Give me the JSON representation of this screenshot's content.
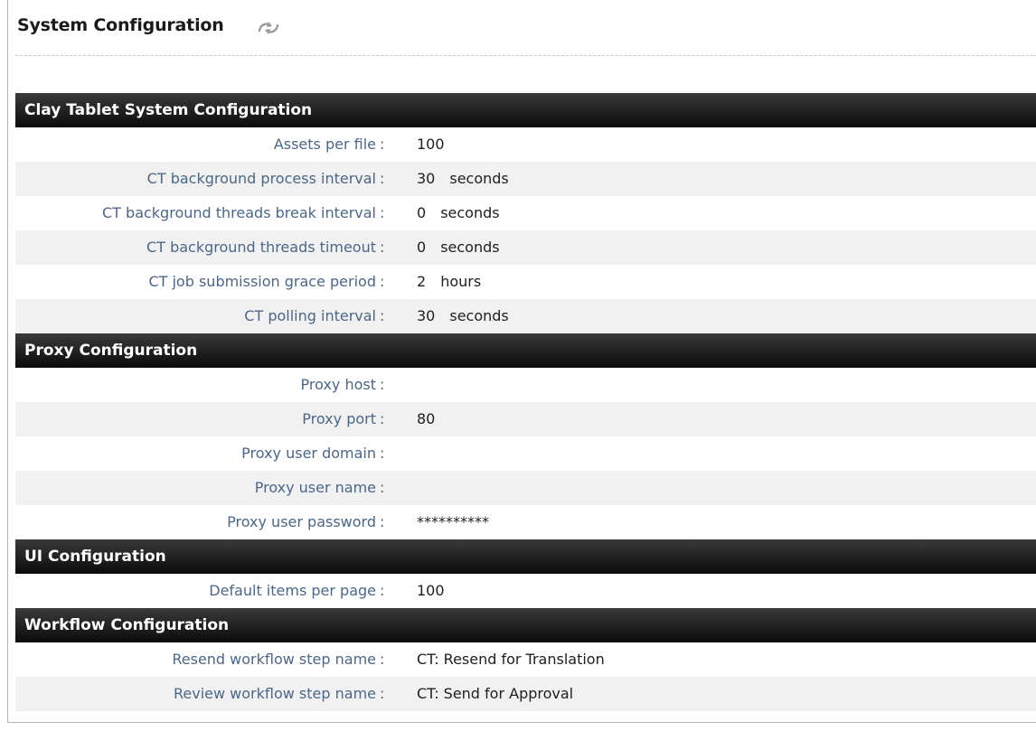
{
  "page": {
    "title": "System Configuration",
    "refresh_icon": "refresh-arrows-icon"
  },
  "sections": [
    {
      "title": "Clay Tablet System Configuration",
      "rows": [
        {
          "label": "Assets per file",
          "value": "100",
          "unit": ""
        },
        {
          "label": "CT background process interval",
          "value": "30",
          "unit": "seconds"
        },
        {
          "label": "CT background threads break interval",
          "value": "0",
          "unit": "seconds"
        },
        {
          "label": "CT background threads timeout",
          "value": "0",
          "unit": "seconds"
        },
        {
          "label": "CT job submission grace period",
          "value": "2",
          "unit": "hours"
        },
        {
          "label": "CT polling interval",
          "value": "30",
          "unit": "seconds"
        }
      ]
    },
    {
      "title": "Proxy Configuration",
      "rows": [
        {
          "label": "Proxy host",
          "value": "",
          "unit": ""
        },
        {
          "label": "Proxy port",
          "value": "80",
          "unit": ""
        },
        {
          "label": "Proxy user domain",
          "value": "",
          "unit": ""
        },
        {
          "label": "Proxy user name",
          "value": "",
          "unit": ""
        },
        {
          "label": "Proxy user password",
          "value": "**********",
          "unit": ""
        }
      ]
    },
    {
      "title": "UI Configuration",
      "rows": [
        {
          "label": "Default items per page",
          "value": "100",
          "unit": ""
        }
      ]
    },
    {
      "title": "Workflow Configuration",
      "rows": [
        {
          "label": "Resend workflow step name",
          "value": "CT: Resend for Translation",
          "unit": ""
        },
        {
          "label": "Review workflow step name",
          "value": "CT: Send for Approval",
          "unit": ""
        }
      ]
    }
  ],
  "colon": ":",
  "colors": {
    "label": "#4a6789",
    "header_bg": "#1a1a1a",
    "row_alt": "#f1f1f1"
  }
}
